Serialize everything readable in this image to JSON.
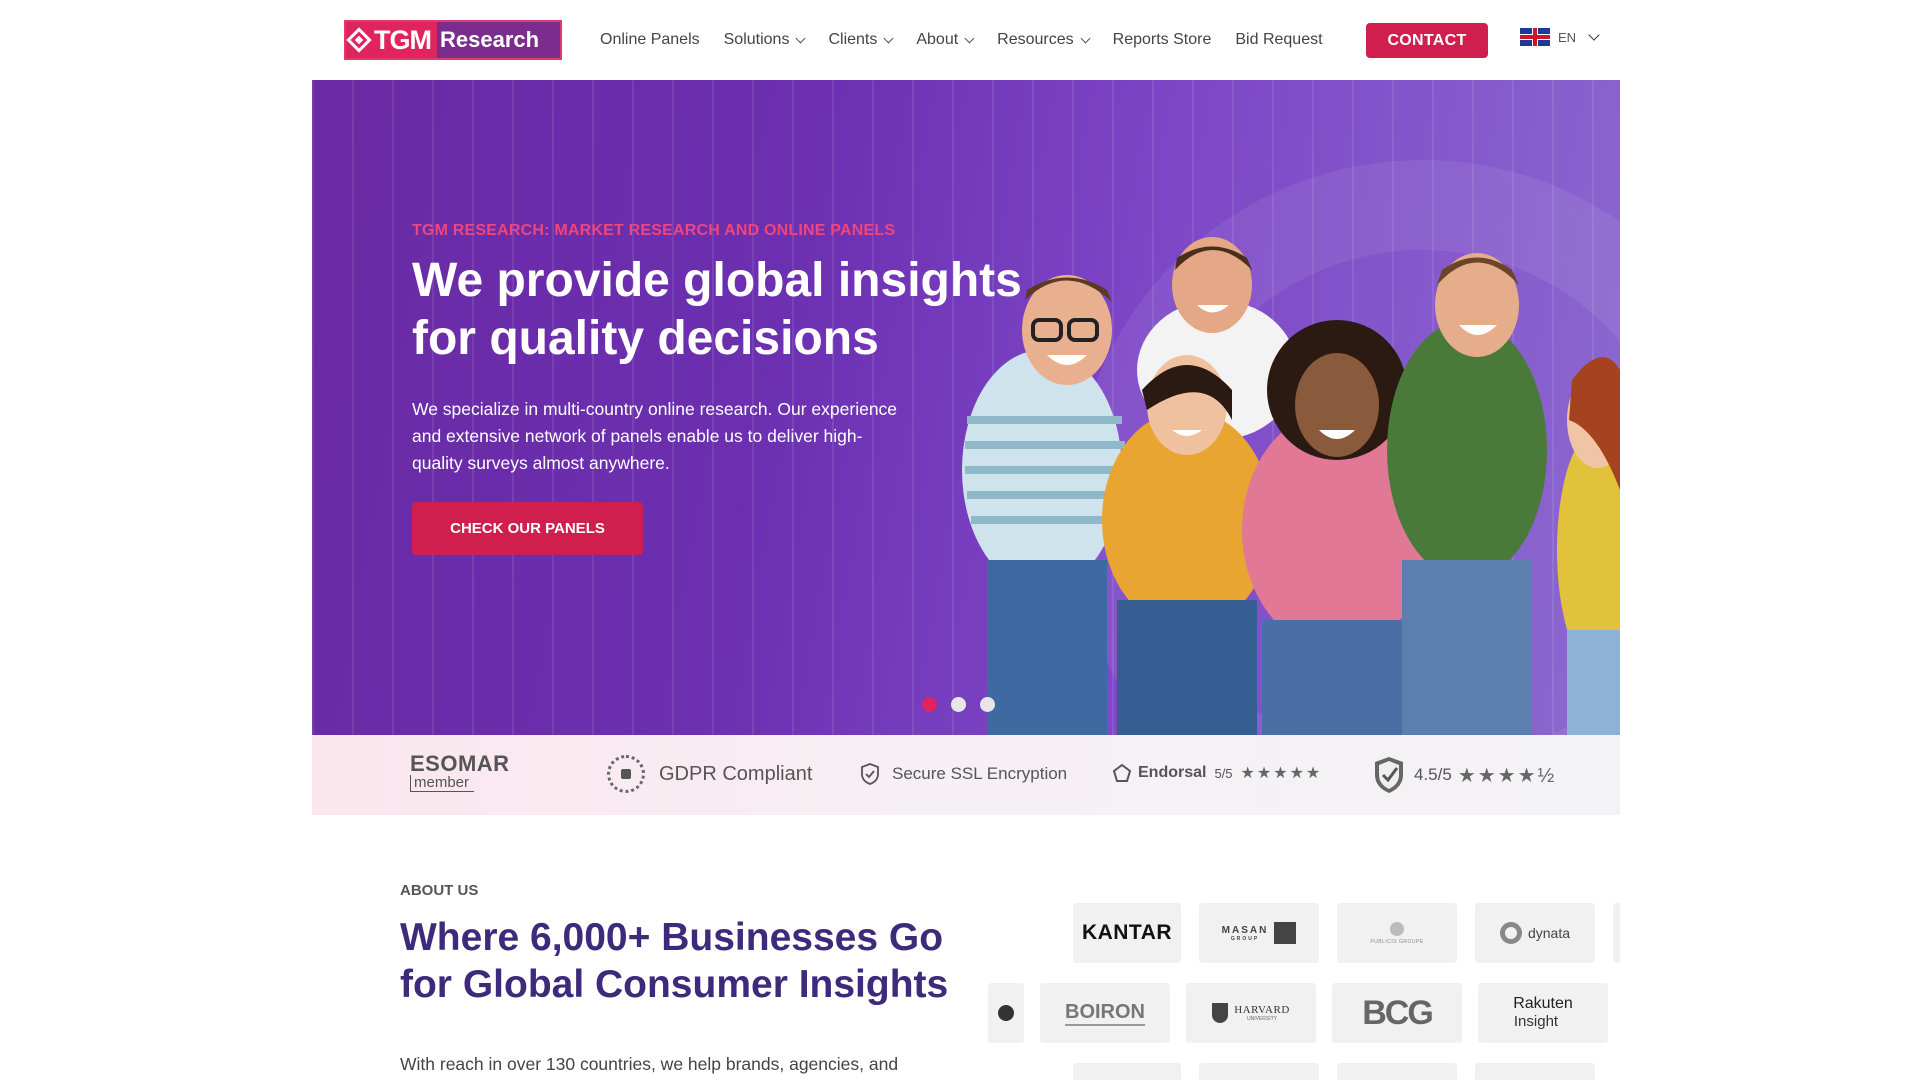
{
  "header": {
    "logo": {
      "part1": "TGM",
      "part2": "Research"
    },
    "nav": [
      {
        "label": "Online Panels",
        "dropdown": false
      },
      {
        "label": "Solutions",
        "dropdown": true
      },
      {
        "label": "Clients",
        "dropdown": true
      },
      {
        "label": "About",
        "dropdown": true
      },
      {
        "label": "Resources",
        "dropdown": true
      },
      {
        "label": "Reports Store",
        "dropdown": false
      },
      {
        "label": "Bid Request",
        "dropdown": false
      }
    ],
    "contact_label": "CONTACT",
    "language": "EN"
  },
  "hero": {
    "kicker": "TGM RESEARCH: MARKET RESEARCH AND ONLINE PANELS",
    "title_line1": "We provide global insights",
    "title_line2": "for quality decisions",
    "description": "We specialize in multi-country online research. Our experience and extensive network of panels enable us to deliver high-quality surveys almost anywhere.",
    "cta_label": "CHECK OUR PANELS",
    "slides": 3,
    "active_slide": 1
  },
  "trust_bar": {
    "esomar_big": "ESOMAR",
    "esomar_small": "member",
    "gdpr": "GDPR Compliant",
    "ssl": "Secure SSL Encryption",
    "endorsal_name": "Endorsal",
    "endorsal_score": "5/5",
    "endorsal_stars": "★★★★★",
    "rating_score": "4.5/5",
    "rating_stars": "★★★★½"
  },
  "about": {
    "kicker": "ABOUT US",
    "title_line1": "Where 6,000+ Businesses Go",
    "title_line2": "for Global Consumer Insights",
    "description": "With reach in over 130 countries, we help brands, agencies, and"
  },
  "client_logos": {
    "row1": [
      "KANTAR",
      "MASAN",
      "PUBLICIS GROUPE",
      "dynata"
    ],
    "row2": [
      "BOIRON",
      "HARVARD",
      "BCG",
      "Rakuten",
      "Insight"
    ],
    "masan_sub": "GROUP",
    "harvard_sub": "UNIVERSITY"
  },
  "colors": {
    "brand_pink": "#d01f4f",
    "brand_purple": "#3d2a7a",
    "hero_purple": "#6b2fb0"
  }
}
